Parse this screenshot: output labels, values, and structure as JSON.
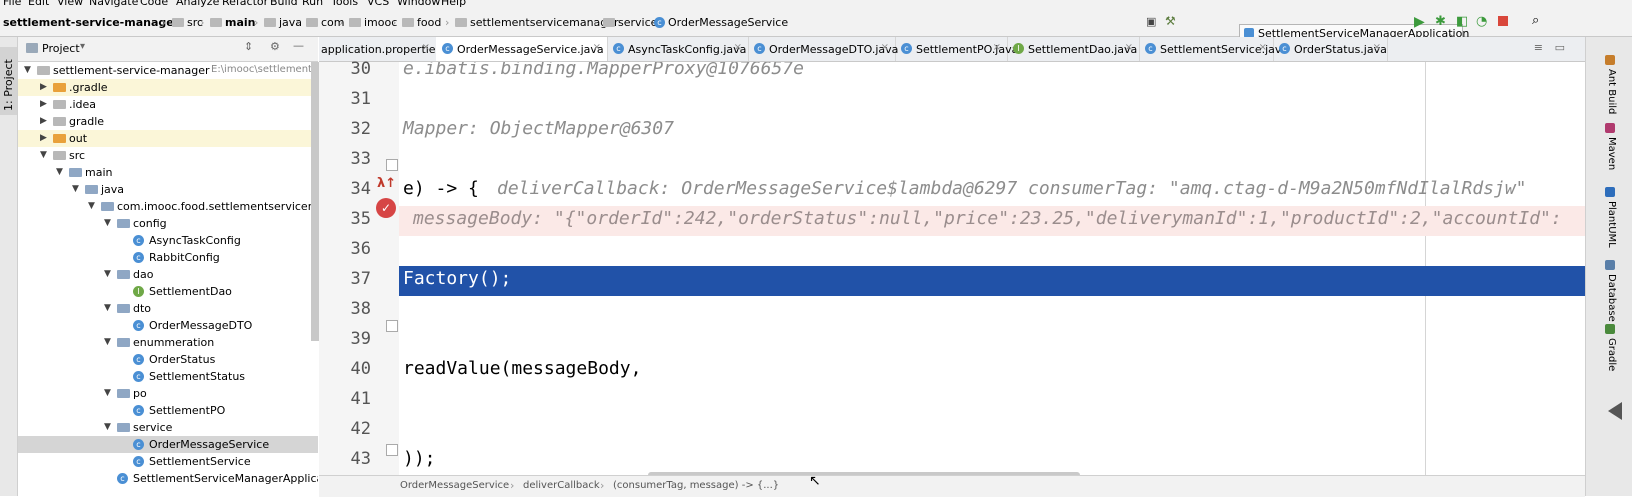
{
  "menu": [
    "File",
    "Edit",
    "View",
    "Navigate",
    "Code",
    "Analyze",
    "Refactor",
    "Build",
    "Run",
    "Tools",
    "VCS",
    "Window",
    "Help"
  ],
  "breadcrumb": [
    "settlement-service-manager",
    "src",
    "main",
    "java",
    "com",
    "imooc",
    "food",
    "settlementservicemanager",
    "service",
    "OrderMessageService"
  ],
  "run_config": "SettlementServiceManagerApplication",
  "left_strip_label": "1: Project",
  "project_header": "Project",
  "tree": [
    {
      "label": "settlement-service-manager",
      "path": "E:\\imooc\\settlement-servi",
      "level": 0,
      "kind": "folder",
      "expanded": true
    },
    {
      "label": ".gradle",
      "level": 1,
      "kind": "folder-orange",
      "expanded": false
    },
    {
      "label": ".idea",
      "level": 1,
      "kind": "folder",
      "expanded": false
    },
    {
      "label": "gradle",
      "level": 1,
      "kind": "folder",
      "expanded": false
    },
    {
      "label": "out",
      "level": 1,
      "kind": "folder-orange",
      "expanded": false
    },
    {
      "label": "src",
      "level": 1,
      "kind": "folder",
      "expanded": true
    },
    {
      "label": "main",
      "level": 2,
      "kind": "folder",
      "expanded": true
    },
    {
      "label": "java",
      "level": 3,
      "kind": "folder",
      "expanded": true
    },
    {
      "label": "com.imooc.food.settlementservicemanage",
      "level": 4,
      "kind": "folder",
      "expanded": true
    },
    {
      "label": "config",
      "level": 5,
      "kind": "folder",
      "expanded": true
    },
    {
      "label": "AsyncTaskConfig",
      "level": 6,
      "kind": "class"
    },
    {
      "label": "RabbitConfig",
      "level": 6,
      "kind": "class"
    },
    {
      "label": "dao",
      "level": 5,
      "kind": "folder",
      "expanded": true
    },
    {
      "label": "SettlementDao",
      "level": 6,
      "kind": "interface"
    },
    {
      "label": "dto",
      "level": 5,
      "kind": "folder",
      "expanded": true
    },
    {
      "label": "OrderMessageDTO",
      "level": 6,
      "kind": "class"
    },
    {
      "label": "enummeration",
      "level": 5,
      "kind": "folder",
      "expanded": true
    },
    {
      "label": "OrderStatus",
      "level": 6,
      "kind": "class"
    },
    {
      "label": "SettlementStatus",
      "level": 6,
      "kind": "class"
    },
    {
      "label": "po",
      "level": 5,
      "kind": "folder",
      "expanded": true
    },
    {
      "label": "SettlementPO",
      "level": 6,
      "kind": "class"
    },
    {
      "label": "service",
      "level": 5,
      "kind": "folder",
      "expanded": true
    },
    {
      "label": "OrderMessageService",
      "level": 6,
      "kind": "class",
      "selected": true
    },
    {
      "label": "SettlementService",
      "level": 6,
      "kind": "class"
    },
    {
      "label": "SettlementServiceManagerApplication",
      "level": 5,
      "kind": "class"
    }
  ],
  "tabs": [
    {
      "label": "application.properties",
      "active": false
    },
    {
      "label": "OrderMessageService.java",
      "active": true
    },
    {
      "label": "AsyncTaskConfig.java",
      "active": false
    },
    {
      "label": "OrderMessageDTO.java",
      "active": false
    },
    {
      "label": "SettlementPO.java",
      "active": false
    },
    {
      "label": "SettlementDao.java",
      "active": false
    },
    {
      "label": "SettlementService.java",
      "active": false
    },
    {
      "label": "OrderStatus.java",
      "active": false
    }
  ],
  "code_lines": [
    {
      "n": "30",
      "text": "e.ibatis.binding.MapperProxy@1076657e",
      "style": "hint"
    },
    {
      "n": "31",
      "text": "",
      "style": ""
    },
    {
      "n": "32",
      "text": "Mapper: ObjectMapper@6307",
      "style": "hint"
    },
    {
      "n": "33",
      "text": "",
      "style": ""
    },
    {
      "n": "34",
      "text": "e) -> {",
      "hint": "deliverCallback: OrderMessageService$lambda@6297  consumerTag: \"amq.ctag-d-M9a2N50mfNdIlalRdsjw\"",
      "style": ""
    },
    {
      "n": "35",
      "text": "messageBody: \"{\"orderId\":242,\"orderStatus\":null,\"price\":23.25,\"deliverymanId\":1,\"productId\":2,\"accountId\":",
      "style": "hint-bp"
    },
    {
      "n": "36",
      "text": "",
      "style": ""
    },
    {
      "n": "37",
      "text": "Factory();",
      "style": "sel"
    },
    {
      "n": "38",
      "text": "",
      "style": ""
    },
    {
      "n": "39",
      "text": "",
      "style": ""
    },
    {
      "n": "40",
      "text": "readValue(messageBody,",
      "style": ""
    },
    {
      "n": "41",
      "text": "",
      "style": ""
    },
    {
      "n": "42",
      "text": "",
      "style": ""
    },
    {
      "n": "43",
      "text": "));",
      "style": ""
    }
  ],
  "status_breadcrumb": [
    "OrderMessageService",
    "deliverCallback",
    "(consumerTag, message) -> {...}"
  ],
  "right_tools": [
    "Ant Build",
    "Maven",
    "PlantUML",
    "Database",
    "Gradle"
  ]
}
